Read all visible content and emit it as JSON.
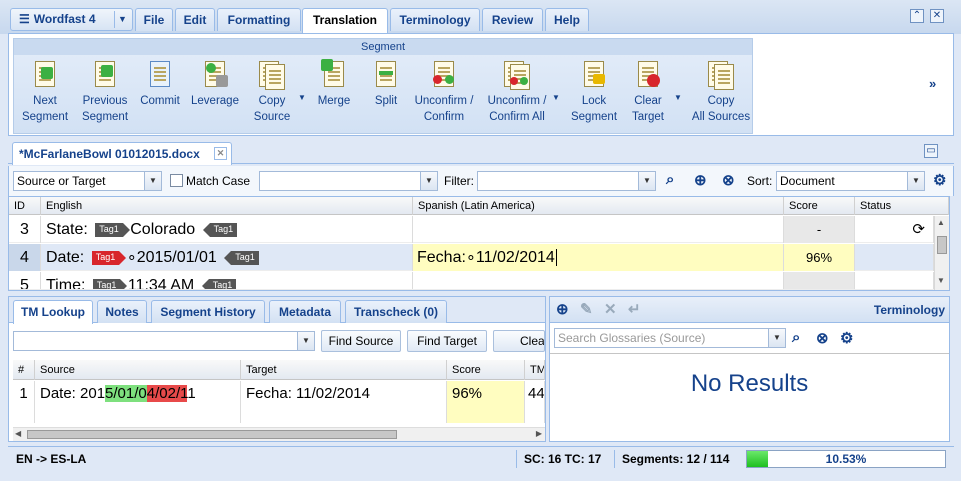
{
  "app": {
    "menu_label": "Wordfast 4"
  },
  "tabs": [
    {
      "label": "File"
    },
    {
      "label": "Edit"
    },
    {
      "label": "Formatting"
    },
    {
      "label": "Translation"
    },
    {
      "label": "Terminology"
    },
    {
      "label": "Review"
    },
    {
      "label": "Help"
    }
  ],
  "ribbon": {
    "group_title": "Segment",
    "buttons": [
      {
        "line1": "Next",
        "line2": "Segment"
      },
      {
        "line1": "Previous",
        "line2": "Segment"
      },
      {
        "line1": "Commit",
        "line2": ""
      },
      {
        "line1": "Leverage",
        "line2": ""
      },
      {
        "line1": "Copy",
        "line2": "Source"
      },
      {
        "line1": "Merge",
        "line2": ""
      },
      {
        "line1": "Split",
        "line2": ""
      },
      {
        "line1": "Unconfirm /",
        "line2": "Confirm"
      },
      {
        "line1": "Unconfirm /",
        "line2": "Confirm All"
      },
      {
        "line1": "Lock",
        "line2": "Segment"
      },
      {
        "line1": "Clear",
        "line2": "Target"
      },
      {
        "line1": "Copy",
        "line2": "All Sources"
      }
    ],
    "more": "»"
  },
  "document": {
    "tab_label": "*McFarlaneBowl 01012015.docx"
  },
  "filter": {
    "scope_value": "Source or Target",
    "match_case_label": "Match Case",
    "search_value": "",
    "filter_label": "Filter:",
    "filter_value": "",
    "sort_label": "Sort:",
    "sort_value": "Document"
  },
  "grid": {
    "columns": [
      "ID",
      "English",
      "Spanish (Latin America)",
      "Score",
      "Status"
    ],
    "rows": [
      {
        "id": "3",
        "src_pre": "State:",
        "tag1": "Tag1",
        "src_mid": "Colorado",
        "tag2": "Tag1",
        "target": "",
        "score": "-",
        "status": "⟳"
      },
      {
        "id": "4",
        "src_pre": "Date:",
        "tag1": "Tag1",
        "src_mid": "∘2015/01/01",
        "tag2": "Tag1",
        "target": "Fecha:∘11/02/2014",
        "score": "96%",
        "status": ""
      },
      {
        "id": "5",
        "src_pre": "Time:",
        "tag1": "Tag1",
        "src_mid": "11:34 AM",
        "tag2": "Tag1",
        "target": "",
        "score": "",
        "status": ""
      }
    ]
  },
  "bottom_tabs": [
    {
      "label": "TM Lookup"
    },
    {
      "label": "Notes"
    },
    {
      "label": "Segment History"
    },
    {
      "label": "Metadata"
    },
    {
      "label": "Transcheck (0)"
    }
  ],
  "tm": {
    "combo_value": "",
    "find_source": "Find Source",
    "find_target": "Find Target",
    "clear": "Clear",
    "columns": [
      "#",
      "Source",
      "Target",
      "Score",
      "TM"
    ],
    "row": {
      "num": "1",
      "src_a": "Date: 201",
      "src_b": "5/01/0",
      "src_c": "4/02/1",
      "src_d": "1",
      "target": "Fecha: 11/02/2014",
      "score": "96%",
      "tm": "44"
    }
  },
  "terminology": {
    "title": "Terminology",
    "search_placeholder": "Search Glossaries (Source)",
    "no_results": "No Results"
  },
  "status": {
    "lang_pair": "EN -> ES-LA",
    "sc_tc": "SC: 16 TC: 17",
    "segments": "Segments: 12 / 114",
    "progress_text": "10.53%",
    "progress_value": 0.1053
  }
}
